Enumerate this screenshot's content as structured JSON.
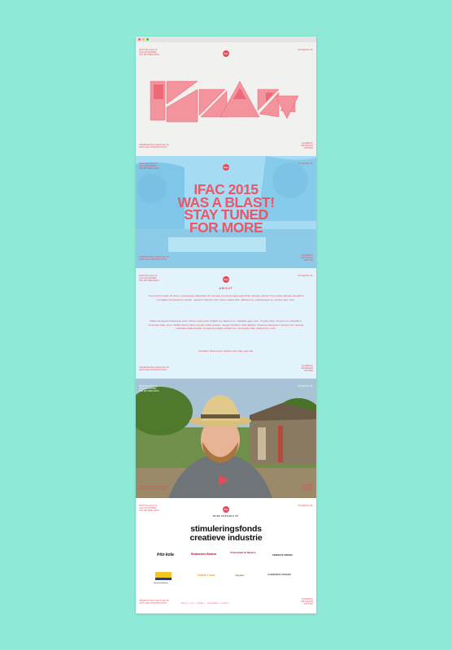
{
  "meta": {
    "accent": "#e8495a",
    "background": "#8ee9d6",
    "cyan_tint": "#8fd3ee"
  },
  "header": {
    "address": "FESTIVALLAAN 12\n1234 AB ARNHEM\nTHE NETHERLANDS",
    "contact": "INFO@IFAC.NL",
    "logo": "ifac"
  },
  "footer_info": {
    "left": "INTERNATIONAL FESTIVAL OF\nARTS AND CONSTRUCTION",
    "right": "FACEBOOK\nINSTAGRAM\nTWITTER"
  },
  "hero": {
    "title": "IFAC 2015\nWAS A BLAST!\nSTAY TUNED\nFOR MORE"
  },
  "about": {
    "heading": "ABOUT",
    "p1": "Lorem ipsum dolor sit amet, consectetuer adipiscing elit. Aenean commodo ligula eget dolor. Aenean massa. Cum sociis natoque penatibus et magnis dis parturient montes, nascetur ridiculus mus. Donec quam felis, ultricies nec, pellentesque eu, pretium quis, sem.",
    "p2": "Nulla consequat massa quis enim. Donec pede justo, fringilla vel, aliquet nec, vulputate eget, arcu. In enim justo, rhoncus ut, imperdiet a, venenatis vitae, justo. Nullam dictum felis eu pede mollis pretium. Integer tincidunt. Cras dapibus. Vivamus elementum semper nisi. Aenean vulputate eleifend tellus. Aenean leo ligula, porttitor eu, consequat vitae, eleifend ac, enim.",
    "p3": "Curabitur ullamcorper ultricies nisi. Nam eget dui."
  },
  "sponsors": {
    "heading": "MADE POSSIBLE BY",
    "main": "stimuleringsfonds\ncreatieve industrie",
    "logos": [
      "fritz-kola",
      "Budweiser Budvar",
      "Universidad de Navarra",
      "GEMEENTE ARNHEM",
      "Gemeente Arnhem",
      "Smits Loos",
      "Vrijstaat",
      "AANNEMERS ARNHEM"
    ],
    "legal": "IFAC.NL © 2015 — PRIVACY — DISCLAIMER — CONTACT"
  },
  "video": {
    "play_label": "play"
  }
}
